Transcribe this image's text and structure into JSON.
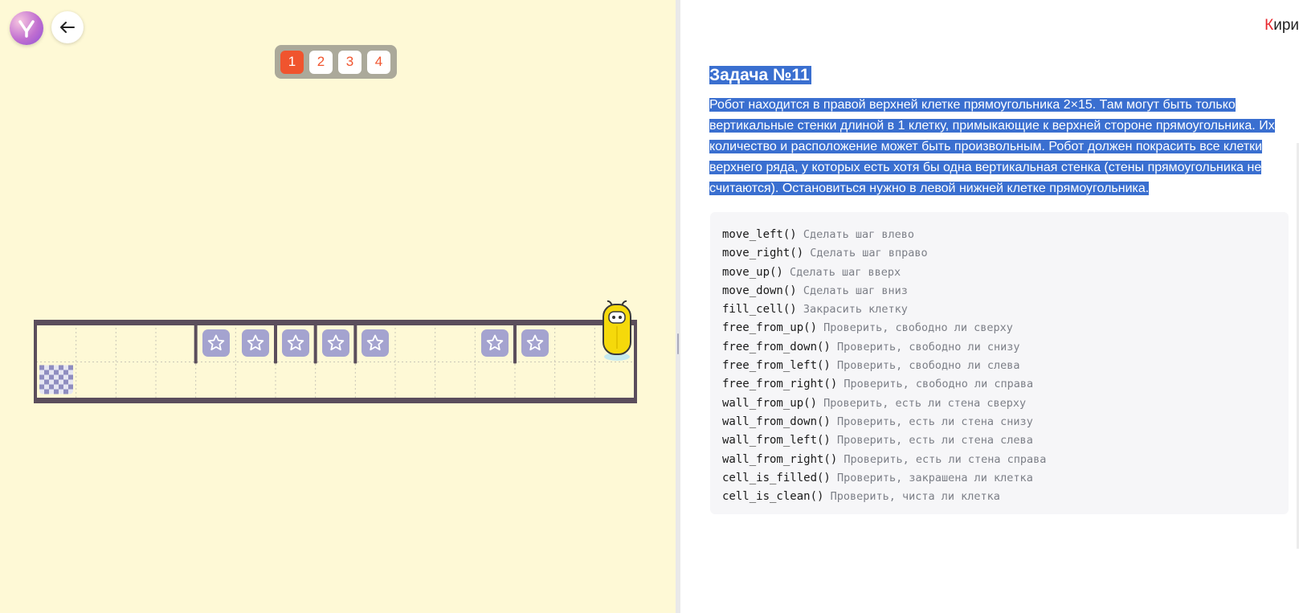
{
  "levels": {
    "items": [
      "1",
      "2",
      "3",
      "4"
    ],
    "active": "1"
  },
  "user": {
    "name_first_letter": "К",
    "name_rest": "ири"
  },
  "task": {
    "title": "Задача №11",
    "description_lines": [
      "Робот находится в правой верхней клетке прямоугольника 2×15. Там могут быть только",
      "вертикальные стенки длиной в 1 клетку, примыкающие к верхней стороне прямоугольника. Их",
      "количество и расположение может быть произвольным. Робот должен покрасить все клетки",
      "верхнего ряда, у которых есть хотя бы одна вертикальная стенка (стены прямоугольника не",
      "считаются). Остановиться нужно в левой нижней клетке прямоугольника."
    ]
  },
  "commands": [
    {
      "name": "move_left()",
      "desc": "Сделать шаг влево"
    },
    {
      "name": "move_right()",
      "desc": "Сделать шаг вправо"
    },
    {
      "name": "move_up()",
      "desc": "Сделать шаг вверх"
    },
    {
      "name": "move_down()",
      "desc": "Сделать шаг вниз"
    },
    {
      "name": "fill_cell()",
      "desc": "Закрасить клетку"
    },
    {
      "name": "free_from_up()",
      "desc": "Проверить, свободно ли сверху"
    },
    {
      "name": "free_from_down()",
      "desc": "Проверить, свободно ли снизу"
    },
    {
      "name": "free_from_left()",
      "desc": "Проверить, свободно ли слева"
    },
    {
      "name": "free_from_right()",
      "desc": "Проверить, свободно ли справа"
    },
    {
      "name": "wall_from_up()",
      "desc": "Проверить, есть ли стена сверху"
    },
    {
      "name": "wall_from_down()",
      "desc": "Проверить, есть ли стена снизу"
    },
    {
      "name": "wall_from_left()",
      "desc": "Проверить, есть ли стена слева"
    },
    {
      "name": "wall_from_right()",
      "desc": "Проверить, есть ли стена справа"
    },
    {
      "name": "cell_is_filled()",
      "desc": "Проверить, закрашена ли клетка"
    },
    {
      "name": "cell_is_clean()",
      "desc": "Проверить, чиста ли клетка"
    }
  ],
  "grid": {
    "rows": 2,
    "cols": 15,
    "star_cells_top_row": [
      4,
      5,
      6,
      7,
      8,
      11,
      12
    ],
    "wall_between_cols_top_row": [
      [
        3,
        4
      ],
      [
        5,
        6
      ],
      [
        6,
        7
      ],
      [
        7,
        8
      ],
      [
        11,
        12
      ]
    ],
    "robot": {
      "row": 0,
      "col": 14
    },
    "target": {
      "row": 1,
      "col": 0
    }
  },
  "colors": {
    "left_background": "#fef9d6",
    "accent": "#f0542e",
    "star_cell": "#a4a3cf",
    "selection": "#3a6fd0",
    "robot": "#f5d90b"
  },
  "icons": {
    "logo": "logo-icon",
    "back": "arrow-left-icon",
    "star": "star-icon",
    "robot": "robot-icon",
    "finish": "checkered-flag-icon"
  }
}
